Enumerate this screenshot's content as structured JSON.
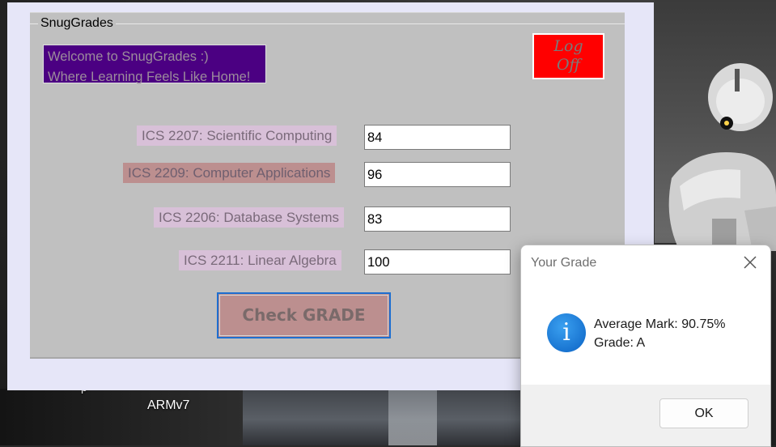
{
  "desktop": {
    "label": "ARMv7",
    "partial_label": "p"
  },
  "app": {
    "title": "SnugGrades",
    "welcome_line1": "Welcome to SnugGrades :)",
    "welcome_line2": "Where Learning Feels Like Home!",
    "logoff_line1": "Log",
    "logoff_line2": "Off",
    "courses": [
      {
        "label": "ICS 2207: Scientific Computing",
        "mark": "84"
      },
      {
        "label": "ICS 2209: Computer Applications",
        "mark": "96"
      },
      {
        "label": "ICS 2206: Database Systems",
        "mark": "83"
      },
      {
        "label": "ICS 2211: Linear Algebra",
        "mark": "100"
      }
    ],
    "check_button": "Check GRADE"
  },
  "dialog": {
    "title": "Your Grade",
    "info_glyph": "i",
    "message_line1": "Average Mark: 90.75%",
    "message_line2": "Grade: A",
    "ok_label": "OK"
  },
  "colors": {
    "welcome_bg": "#4b0082",
    "logoff_bg": "#ff0000",
    "label_bg": "#d8c0d8",
    "label_alt_bg": "#bc8f8f",
    "check_bg": "#bc8f8f",
    "info_blue": "#0b62c4"
  },
  "icons": [
    "close-icon",
    "info-icon"
  ]
}
